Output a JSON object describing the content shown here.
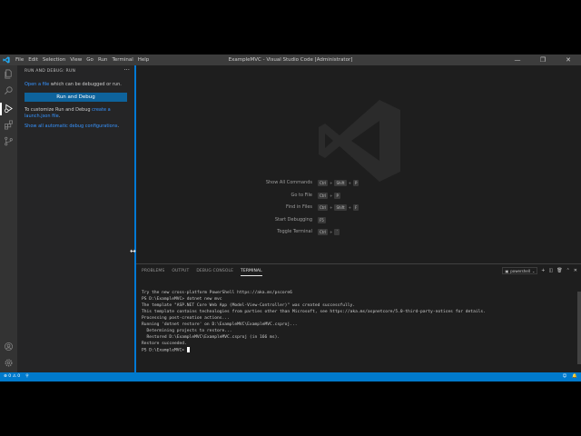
{
  "window": {
    "title": "ExampleMVC - Visual Studio Code [Administrator]",
    "controls": {
      "minimize": "—",
      "maximize": "❐",
      "close": "✕"
    }
  },
  "menu": [
    "File",
    "Edit",
    "Selection",
    "View",
    "Go",
    "Run",
    "Terminal",
    "Help"
  ],
  "activity_bar": {
    "icons": [
      "files-icon",
      "search-icon",
      "run-debug-icon",
      "extensions-icon",
      "source-control-icon",
      "account-icon",
      "settings-gear-icon"
    ],
    "active": "run-debug-icon"
  },
  "sidebar": {
    "header": "RUN AND DEBUG: RUN",
    "more": "···",
    "p1_link": "Open a file",
    "p1_text": " which can be debugged or run.",
    "button": "Run and Debug",
    "p2_text": "To customize Run and Debug ",
    "p2_link": "create a launch.json file",
    "p2_end": ".",
    "p3_link": "Show all automatic debug configurations",
    "p3_end": "."
  },
  "editor": {
    "shortcuts": [
      {
        "label": "Show All Commands",
        "keys": [
          "Ctrl",
          "Shift",
          "P"
        ]
      },
      {
        "label": "Go to File",
        "keys": [
          "Ctrl",
          "P"
        ]
      },
      {
        "label": "Find in Files",
        "keys": [
          "Ctrl",
          "Shift",
          "F"
        ]
      },
      {
        "label": "Start Debugging",
        "keys": [
          "F5"
        ]
      },
      {
        "label": "Toggle Terminal",
        "keys": [
          "Ctrl",
          "`"
        ]
      }
    ]
  },
  "panel": {
    "tabs": [
      "PROBLEMS",
      "OUTPUT",
      "DEBUG CONSOLE",
      "TERMINAL"
    ],
    "active_tab": "TERMINAL",
    "shell": "powershell",
    "terminal_lines": [
      "Try the new cross-platform PowerShell https://aka.ms/pscore6",
      "",
      "PS D:\\ExampleMVC> dotnet new mvc",
      "The template \"ASP.NET Core Web App (Model-View-Controller)\" was created successfully.",
      "This template contains technologies from parties other than Microsoft, see https://aka.ms/aspnetcore/5.0-third-party-notices for details.",
      "",
      "Processing post-creation actions...",
      "Running 'dotnet restore' on D:\\ExampleMVC\\ExampleMVC.csproj...",
      "  Determining projects to restore...",
      "  Restored D:\\ExampleMVC\\ExampleMVC.csproj (in 166 ms).",
      "Restore succeeded.",
      ""
    ],
    "prompt": "PS D:\\ExampleMVC> "
  },
  "statusbar": {
    "errors": "⊗ 0",
    "warnings": "⚠ 0",
    "broadcast": "⚲"
  },
  "colors": {
    "accent": "#007acc",
    "button": "#0e639c",
    "link": "#3794ff",
    "titlebar": "#3c3c3c",
    "sidebar": "#252526",
    "editor": "#1e1e1e"
  }
}
